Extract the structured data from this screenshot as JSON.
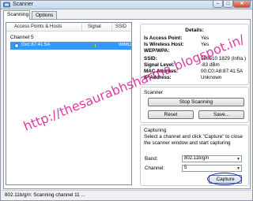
{
  "window": {
    "title": "Scanner"
  },
  "tabs": [
    {
      "label": "Scanning",
      "active": true
    },
    {
      "label": "Options",
      "active": false
    }
  ],
  "ap_list": {
    "columns": [
      "Access Points & Hosts",
      "Signal",
      "SSID"
    ],
    "channel_label": "Channel 5",
    "rows": [
      {
        "name": "Gvc:87:41:5A",
        "ssid": "986610"
      }
    ]
  },
  "details": {
    "title": "Details:",
    "fields": [
      {
        "label": "Is Access Point:",
        "value": "Yes"
      },
      {
        "label": "Is Wireless Host:",
        "value": "Yes"
      },
      {
        "label": "WEP/WPA:",
        "value": ""
      },
      {
        "label": "SSID:",
        "value": "986610 1829 (Infra.)"
      },
      {
        "label": "Signal Level:",
        "value": "-83 dBm"
      },
      {
        "label": "MAC Address:",
        "value": "00:C0:A8:87:41:5A"
      },
      {
        "label": "IP Address:",
        "value": "Unknown"
      }
    ]
  },
  "scanner": {
    "title": "Scanner",
    "stop_label": "Stop Scanning",
    "reset_label": "Reset",
    "save_label": "Save..."
  },
  "capturing": {
    "title": "Capturing",
    "description": "Select a channel and click \"Capture\" to close the scanner window and start capturing",
    "band_label": "Band:",
    "band_value": "802.11b/g/n",
    "channel_label": "Channel:",
    "channel_value": "5",
    "capture_label": "Capture"
  },
  "status": {
    "text": "802.11b/g/n: Scanning channel 11 ..."
  },
  "watermark": {
    "text": "http://thesaurabhsharma.blogspot.in/"
  },
  "colors": {
    "selection": "#3399ff",
    "watermark": "#d6008c",
    "annotation_circle": "#1a1aa8"
  }
}
